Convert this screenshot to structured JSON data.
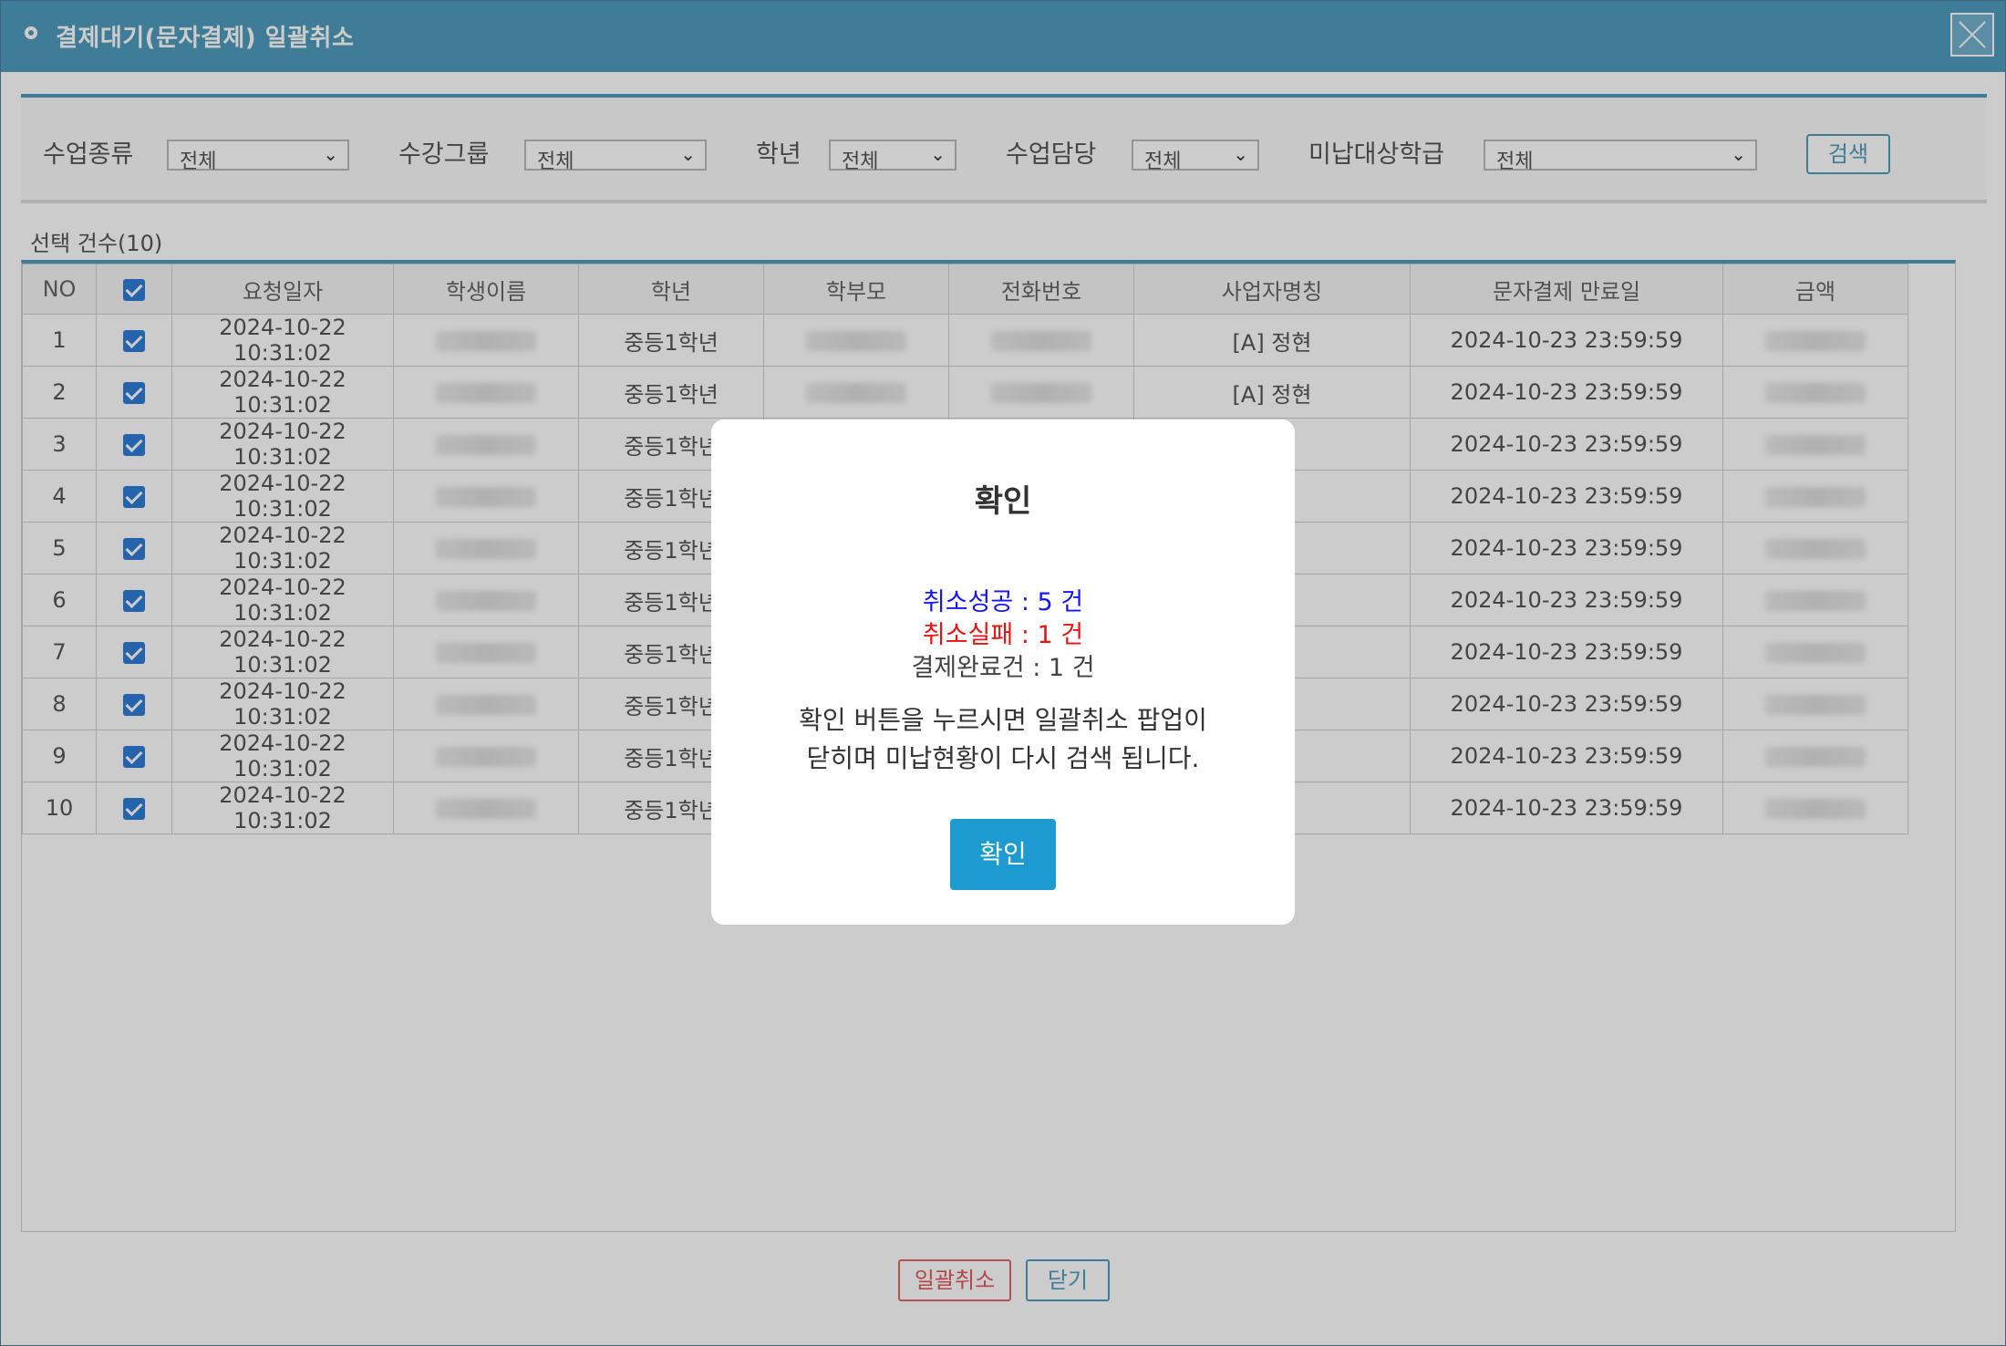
{
  "window": {
    "title": "결제대기(문자결제) 일괄취소",
    "close_icon": "close-x-icon"
  },
  "filters": {
    "class_type": {
      "label": "수업종류",
      "value": "전체"
    },
    "course_group": {
      "label": "수강그룹",
      "value": "전체"
    },
    "grade": {
      "label": "학년",
      "value": "전체"
    },
    "teacher": {
      "label": "수업담당",
      "value": "전체"
    },
    "unpaid_class": {
      "label": "미납대상학급",
      "value": "전체"
    },
    "search_label": "검색"
  },
  "selection": {
    "label": "선택 건수(10)"
  },
  "table": {
    "headers": [
      "NO",
      "요청일자",
      "학생이름",
      "학년",
      "학부모",
      "전화번호",
      "사업자명칭",
      "문자결제 만료일",
      "금액"
    ],
    "rows": [
      {
        "no": "1",
        "date": "2024-10-22 10:31:02",
        "grade": "중등1학년",
        "business": "[A] 정현",
        "expiry": "2024-10-23 23:59:59"
      },
      {
        "no": "2",
        "date": "2024-10-22 10:31:02",
        "grade": "중등1학년",
        "business": "[A] 정현",
        "expiry": "2024-10-23 23:59:59"
      },
      {
        "no": "3",
        "date": "2024-10-22 10:31:02",
        "grade": "중등1학년",
        "business": "",
        "expiry": "2024-10-23 23:59:59"
      },
      {
        "no": "4",
        "date": "2024-10-22 10:31:02",
        "grade": "중등1학년",
        "business": "",
        "expiry": "2024-10-23 23:59:59"
      },
      {
        "no": "5",
        "date": "2024-10-22 10:31:02",
        "grade": "중등1학년",
        "business": "",
        "expiry": "2024-10-23 23:59:59"
      },
      {
        "no": "6",
        "date": "2024-10-22 10:31:02",
        "grade": "중등1학년",
        "business": "",
        "expiry": "2024-10-23 23:59:59"
      },
      {
        "no": "7",
        "date": "2024-10-22 10:31:02",
        "grade": "중등1학년",
        "business": "",
        "expiry": "2024-10-23 23:59:59"
      },
      {
        "no": "8",
        "date": "2024-10-22 10:31:02",
        "grade": "중등1학년",
        "business": "",
        "expiry": "2024-10-23 23:59:59"
      },
      {
        "no": "9",
        "date": "2024-10-22 10:31:02",
        "grade": "중등1학년",
        "business": "",
        "expiry": "2024-10-23 23:59:59"
      },
      {
        "no": "10",
        "date": "2024-10-22 10:31:02",
        "grade": "중등1학년",
        "business": "",
        "expiry": "2024-10-23 23:59:59"
      }
    ]
  },
  "footer": {
    "bulk_cancel_label": "일괄취소",
    "close_label": "닫기"
  },
  "modal": {
    "title": "확인",
    "success_text": "취소성공 : 5 건",
    "fail_text": "취소실패 : 1 건",
    "done_text": "결제완료건 : 1 건",
    "message_line1": "확인 버튼을 누르시면 일괄취소 팝업이",
    "message_line2": "닫히며 미납현황이 다시 검색 됩니다.",
    "confirm_label": "확인"
  },
  "colors": {
    "accent": "#4e9bbd",
    "success": "#1515ff",
    "fail": "#ee1111",
    "confirm": "#1b9bd0",
    "bulk_cancel": "#e05a5a"
  }
}
